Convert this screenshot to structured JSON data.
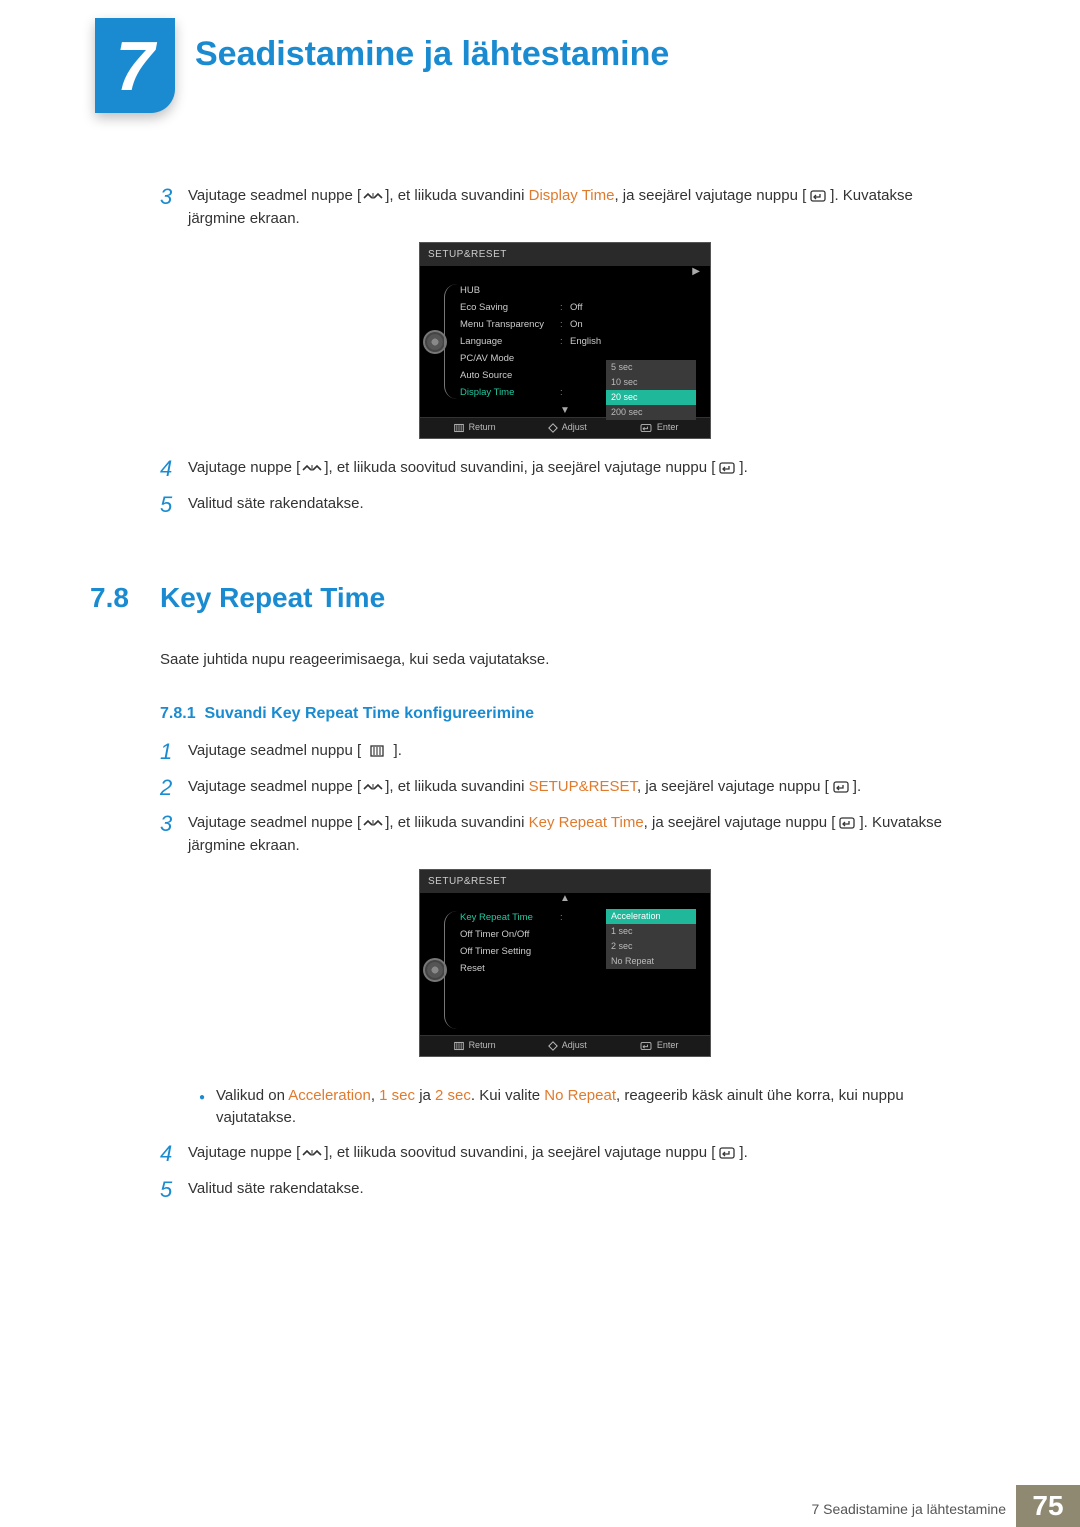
{
  "chapter": {
    "number": "7",
    "title": "Seadistamine ja lähtestamine"
  },
  "top_steps": {
    "s3a": "Vajutage seadmel nuppe [",
    "s3b": "], et liikuda suvandini ",
    "s3hl": "Display Time",
    "s3c": ", ja seejärel vajutage nuppu [",
    "s3d": "]. Kuvatakse järgmine ekraan.",
    "s4a": "Vajutage nuppe [",
    "s4b": "], et liikuda soovitud suvandini, ja seejärel vajutage nuppu [",
    "s4c": "].",
    "s5": "Valitud säte rakendatakse."
  },
  "osd1": {
    "header": "SETUP&RESET",
    "rows": [
      {
        "label": "HUB",
        "val": ""
      },
      {
        "label": "Eco Saving",
        "val": "Off"
      },
      {
        "label": "Menu Transparency",
        "val": "On"
      },
      {
        "label": "Language",
        "val": "English"
      },
      {
        "label": "PC/AV Mode",
        "val": ""
      },
      {
        "label": "Auto Source",
        "val": ""
      },
      {
        "label": "Display Time",
        "val": "",
        "active": true
      }
    ],
    "options": [
      "5 sec",
      "10 sec",
      "20 sec",
      "200 sec"
    ],
    "selected": "20 sec",
    "footer": {
      "return": "Return",
      "adjust": "Adjust",
      "enter": "Enter"
    }
  },
  "section": {
    "num": "7.8",
    "title": "Key Repeat Time",
    "intro": "Saate juhtida nupu reageerimisaega, kui seda vajutatakse.",
    "sub_num": "7.8.1",
    "sub_title": "Suvandi Key Repeat Time konfigureerimine"
  },
  "steps2": {
    "s1a": "Vajutage seadmel nuppu [ ",
    "s1b": " ].",
    "s2a": "Vajutage seadmel nuppe [",
    "s2b": "], et liikuda suvandini ",
    "s2hl": "SETUP&RESET",
    "s2c": ", ja seejärel vajutage nuppu [",
    "s2d": "].",
    "s3a": "Vajutage seadmel nuppe [",
    "s3b": "], et liikuda suvandini ",
    "s3hl": "Key Repeat Time",
    "s3c": ", ja seejärel vajutage nuppu [",
    "s3d": "]. Kuvatakse järgmine ekraan.",
    "bullet_a": "Valikud on ",
    "bullet_h1": "Acceleration",
    "bullet_b": ", ",
    "bullet_h2": "1 sec",
    "bullet_c": " ja ",
    "bullet_h3": "2 sec",
    "bullet_d": ". Kui valite ",
    "bullet_h4": "No Repeat",
    "bullet_e": ", reageerib käsk ainult ühe korra, kui nuppu vajutatakse.",
    "s4a": "Vajutage nuppe [",
    "s4b": "], et liikuda soovitud suvandini, ja seejärel vajutage nuppu [",
    "s4c": "].",
    "s5": "Valitud säte rakendatakse."
  },
  "osd2": {
    "header": "SETUP&RESET",
    "rows": [
      {
        "label": "Key Repeat Time",
        "val": "",
        "active": true
      },
      {
        "label": "Off Timer On/Off",
        "val": ""
      },
      {
        "label": "Off Timer Setting",
        "val": ""
      },
      {
        "label": "Reset",
        "val": ""
      }
    ],
    "options": [
      "Acceleration",
      "1 sec",
      "2 sec",
      "No Repeat"
    ],
    "selected": "Acceleration",
    "footer": {
      "return": "Return",
      "adjust": "Adjust",
      "enter": "Enter"
    }
  },
  "footer": {
    "text": "7 Seadistamine ja lähtestamine",
    "page": "75"
  }
}
